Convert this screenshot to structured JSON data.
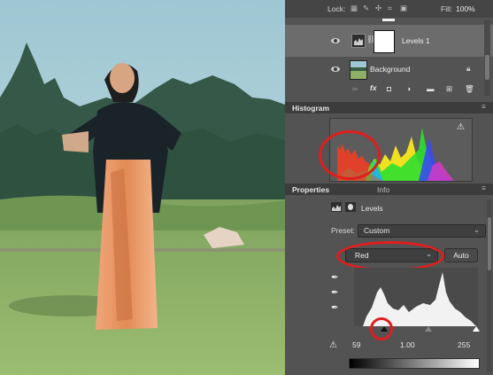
{
  "top_bar": {
    "lock_label": "Lock:",
    "fill_label": "Fill:",
    "fill_value": "100%"
  },
  "layers": [
    {
      "name": "Levels 1"
    },
    {
      "name": "Background"
    }
  ],
  "histogram_panel": {
    "title": "Histogram"
  },
  "properties_panel": {
    "tabs": [
      "Properties",
      "Info"
    ],
    "adjustment_name": "Levels",
    "preset_label": "Preset:",
    "preset_value": "Custom",
    "channel_value": "Red",
    "auto_label": "Auto",
    "input_levels": {
      "black": "59",
      "gamma": "1.00",
      "white": "255"
    }
  },
  "icons": [
    "eye-icon",
    "lock-icon",
    "link-icon",
    "fx-icon",
    "warning-icon",
    "eyedropper-icon",
    "chevron-down-icon"
  ],
  "colors": {
    "panel": "#535353",
    "panel_header": "#3c3c3c",
    "annotation": "#e11d1d",
    "layer_selected": "#6c6c6c"
  }
}
